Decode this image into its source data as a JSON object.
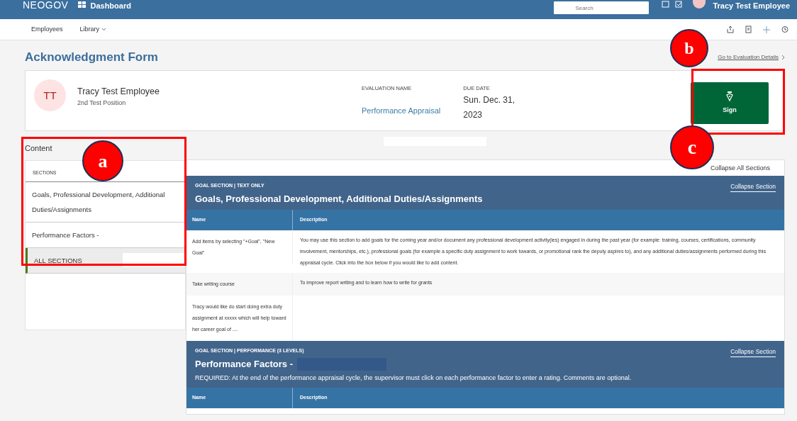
{
  "top_bar": {
    "brand": "NEOGOV",
    "dashboard": "Dashboard",
    "search": {
      "placeholder": "Search"
    },
    "user_name": "Tracy Test Employee"
  },
  "sub_nav": [
    {
      "label": "Employees",
      "dropdown": false
    },
    {
      "label": "Library",
      "dropdown": true
    }
  ],
  "page_title": "Acknowledgment Form",
  "details_link": "Go to Evaluation Details",
  "employee": {
    "initials": "TT",
    "name": "Tracy Test Employee",
    "position": "2nd Test Position"
  },
  "evaluation": {
    "label": "EVALUATION NAME",
    "value": "Performance Appraisal"
  },
  "due": {
    "label": "DUE DATE",
    "value": "Sun. Dec. 31, 2023"
  },
  "sign_button": "Sign",
  "content": {
    "title": "Content",
    "header": "SECTIONS",
    "items": [
      {
        "label": "Goals, Professional Development, Additional Duties/Assignments",
        "selected": false
      },
      {
        "label": "Performance Factors -",
        "selected": false
      },
      {
        "label": "ALL SECTIONS",
        "selected": true
      }
    ]
  },
  "collapse_all": "Collapse All Sections",
  "sections": [
    {
      "type_label": "GOAL SECTION | TEXT ONLY",
      "title": "Goals, Professional Development, Additional Duties/Assignments",
      "collapse": "Collapse Section",
      "columns": [
        "Name",
        "Description"
      ],
      "rows": [
        [
          "Add items by selecting \"+Goal\", \"New Goal\"",
          "You may use this section to add goals for the coming year and/or document any professional development activity(ies) engaged in during the past year (for example: training, courses, certifications, community involvement, mentorships, etc.), professional goals (for example a specific duty assignment to work towards, or promotional rank the deputy aspires to), and any additional duties/assignments performed during this appraisal cycle. Click into the box below if you would like to add content."
        ],
        [
          "Take writing course",
          "To improve report writing and to learn how to write for grants"
        ],
        [
          "Tracy would like do start doing extra duty assignment at xxxxx which will help toward her career goal of ...."
        ]
      ]
    },
    {
      "type_label": "GOAL SECTION | PERFORMANCE (3 LEVELS)",
      "title": "Performance Factors -",
      "collapse": "Collapse Section",
      "note": "REQUIRED: At the end of the performance appraisal cycle, the supervisor must click on each performance factor to enter a rating. Comments are optional.",
      "columns": [
        "Name",
        "Description"
      ]
    }
  ],
  "annotations": [
    {
      "label": "a",
      "boxed": true
    },
    {
      "label": "b",
      "boxed": false
    },
    {
      "label": "c",
      "boxed": true
    }
  ]
}
